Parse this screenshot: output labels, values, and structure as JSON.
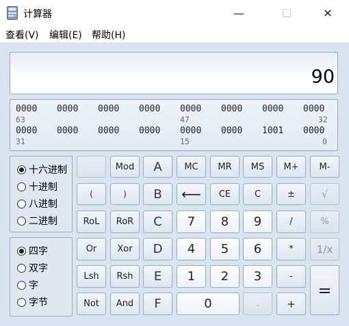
{
  "window": {
    "title": "计算器",
    "minimize": "—",
    "maximize": "☐",
    "close": "✕"
  },
  "menu": [
    "查看(V)",
    "编辑(E)",
    "帮助(H)"
  ],
  "display": {
    "value": "90"
  },
  "bits": {
    "row1": [
      "0000",
      "0000",
      "0000",
      "0000",
      "0000",
      "0000",
      "0000",
      "0000"
    ],
    "row1_pos": [
      "63",
      "47",
      "32"
    ],
    "row2": [
      "0000",
      "0000",
      "0000",
      "0000",
      "0000",
      "0000",
      "1001",
      "0000"
    ],
    "row2_pos": [
      "31",
      "15",
      "0"
    ]
  },
  "radix": {
    "options": [
      "十六进制",
      "十进制",
      "八进制",
      "二进制"
    ],
    "selected": "十六进制"
  },
  "wordsize": {
    "options": [
      "四字",
      "双字",
      "字",
      "字节"
    ],
    "selected": "四字"
  },
  "keys": {
    "blank": "",
    "mod": "Mod",
    "a": "A",
    "mc": "MC",
    "mr": "MR",
    "ms": "MS",
    "mplus": "M+",
    "mminus": "M-",
    "lparen": "(",
    "rparen": ")",
    "b": "B",
    "backspace": "⟵",
    "ce": "CE",
    "c": "C",
    "plusminus": "±",
    "sqrt": "√",
    "rol": "RoL",
    "ror": "RoR",
    "c_hex": "C",
    "seven": "7",
    "eight": "8",
    "nine": "9",
    "divide": "/",
    "percent": "%",
    "or": "Or",
    "xor": "Xor",
    "d": "D",
    "four": "4",
    "five": "5",
    "six": "6",
    "multiply": "*",
    "reciprocal": "1/x",
    "lsh": "Lsh",
    "rsh": "Rsh",
    "e": "E",
    "one": "1",
    "two": "2",
    "three": "3",
    "minus": "-",
    "equals": "=",
    "not": "Not",
    "and": "And",
    "f": "F",
    "zero": "0",
    "dot": ".",
    "plus": "+"
  }
}
